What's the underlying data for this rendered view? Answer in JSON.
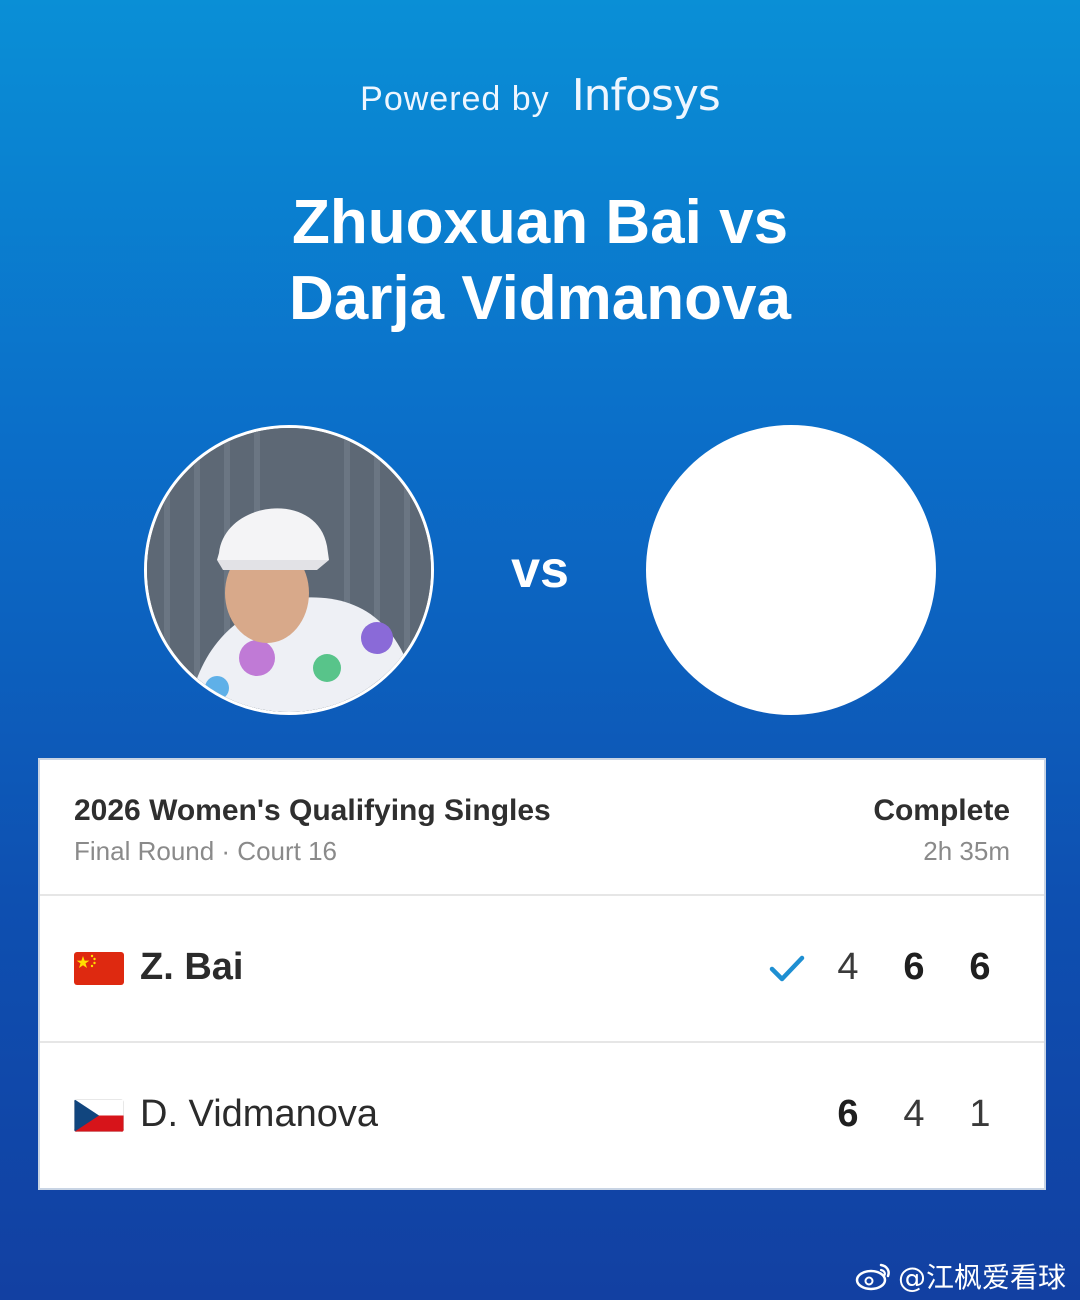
{
  "header": {
    "powered_by": "Powered by",
    "brand": "Infosys"
  },
  "match_title": {
    "line1": "Zhuoxuan Bai vs",
    "line2": "Darja Vidmanova"
  },
  "vs_label": "vs",
  "card": {
    "event": "2026 Women's Qualifying Singles",
    "round_court": "Final Round · Court 16",
    "status": "Complete",
    "duration": "2h 35m"
  },
  "players": [
    {
      "name": "Z. Bai",
      "flag": "china-flag",
      "winner": true,
      "scores": [
        "4",
        "6",
        "6"
      ],
      "won_sets": [
        false,
        true,
        true
      ]
    },
    {
      "name": "D. Vidmanova",
      "flag": "czech-flag",
      "winner": false,
      "scores": [
        "6",
        "4",
        "1"
      ],
      "won_sets": [
        true,
        false,
        false
      ]
    }
  ],
  "colors": {
    "accent_check": "#1e8fd2",
    "china_red": "#de2910",
    "china_yellow": "#ffde00",
    "czech_blue": "#11457e",
    "czech_red": "#d7141a"
  },
  "watermark": "@江枫爱看球"
}
